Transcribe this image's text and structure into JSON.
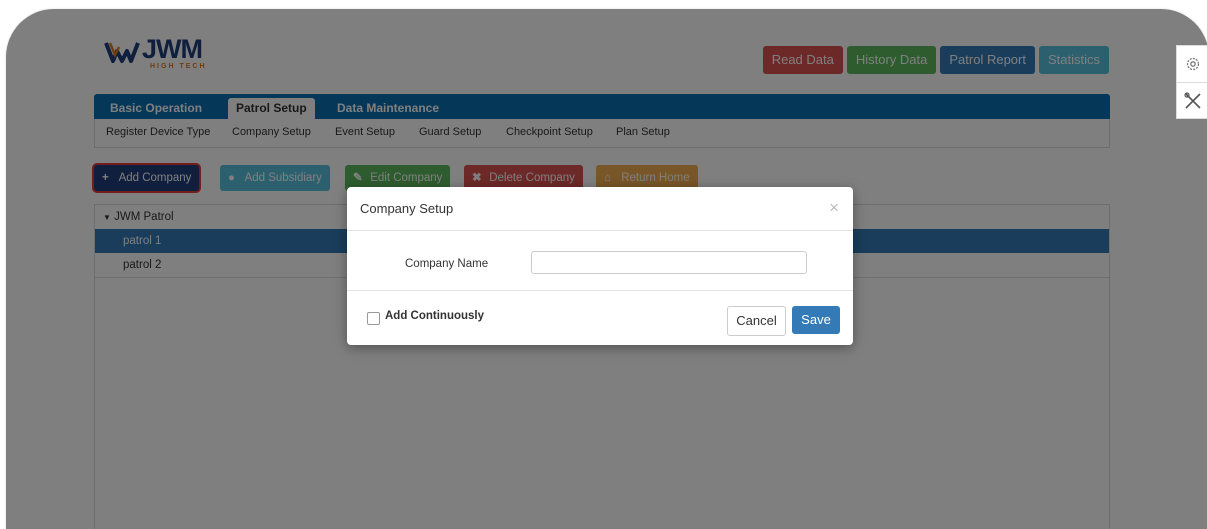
{
  "header": {
    "logo_text": "JWM",
    "logo_subtext": "HIGH TECH",
    "buttons": [
      {
        "label": "Read Data",
        "color": "#d9534f"
      },
      {
        "label": "History Data",
        "color": "#5cb85c"
      },
      {
        "label": "Patrol Report",
        "color": "#337ab7"
      },
      {
        "label": "Statistics",
        "color": "#5bc0de"
      }
    ]
  },
  "nav": {
    "tabs": [
      {
        "label": "Basic Operation",
        "active": false
      },
      {
        "label": "Patrol Setup",
        "active": true
      },
      {
        "label": "Data Maintenance",
        "active": false
      }
    ],
    "subtabs": [
      "Register Device Type",
      "Company Setup",
      "Event Setup",
      "Guard Setup",
      "Checkpoint Setup",
      "Plan Setup"
    ]
  },
  "actions": [
    {
      "label": "Add Company",
      "icon": "plus-icon",
      "color": "#1f3e7a"
    },
    {
      "label": "Add Subsidiary",
      "icon": "plus-circle-icon",
      "color": "#5bc0de"
    },
    {
      "label": "Edit Company",
      "icon": "pencil-icon",
      "color": "#5cb85c"
    },
    {
      "label": "Delete Company",
      "icon": "x-icon",
      "color": "#d9534f"
    },
    {
      "label": "Return Home",
      "icon": "home-icon",
      "color": "#f0ad4e"
    }
  ],
  "tree": {
    "root": "JWM Patrol",
    "children": [
      {
        "label": "patrol 1",
        "selected": true
      },
      {
        "label": "patrol 2",
        "selected": false
      }
    ]
  },
  "modal": {
    "title": "Company Setup",
    "close_glyph": "×",
    "field_label": "Company Name",
    "field_value": "",
    "checkbox_label": "Add Continuously",
    "cancel_label": "Cancel",
    "save_label": "Save"
  },
  "colors": {
    "nav_blue": "#0a6fb0",
    "selected_row": "#337ab7",
    "highlight_border": "#e83a3a"
  }
}
